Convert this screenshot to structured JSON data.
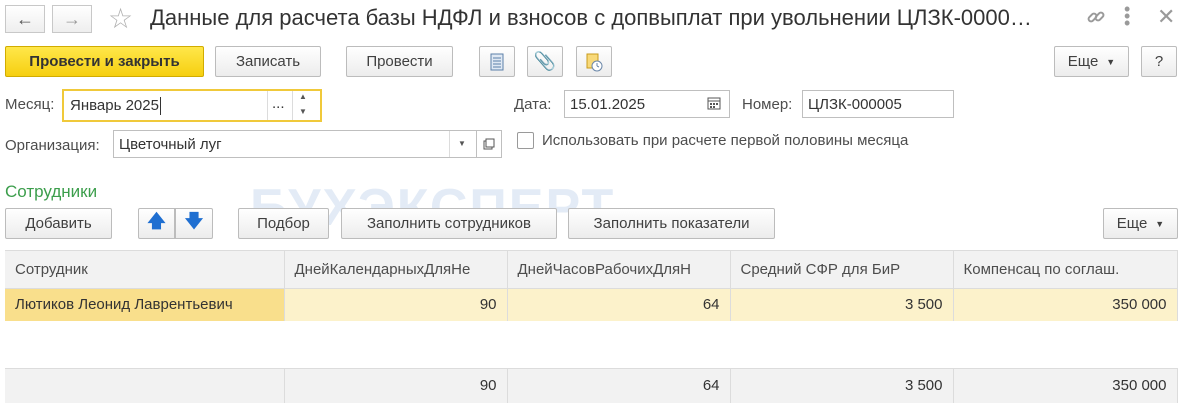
{
  "header": {
    "title": "Данные для расчета базы НДФЛ и взносов с допвыплат при увольнении ЦЛЗК-0000…"
  },
  "toolbar": {
    "post_close": "Провести и закрыть",
    "save": "Записать",
    "post": "Провести",
    "more": "Еще",
    "help": "?"
  },
  "form": {
    "month_label": "Месяц:",
    "month_value": "Январь 2025",
    "date_label": "Дата:",
    "date_value": "15.01.2025",
    "number_label": "Номер:",
    "number_value": "ЦЛЗК-000005",
    "org_label": "Организация:",
    "org_value": "Цветочный луг",
    "first_half_label": "Использовать при расчете первой половины месяца"
  },
  "employees": {
    "title": "Сотрудники",
    "add": "Добавить",
    "select": "Подбор",
    "fill_employees": "Заполнить сотрудников",
    "fill_indicators": "Заполнить показатели",
    "more": "Еще",
    "columns": [
      "Сотрудник",
      "ДнейКалендарныхДляНе",
      "ДнейЧасовРабочихДляН",
      "Средний СФР для БиР",
      "Компенсац по соглаш."
    ],
    "rows": [
      {
        "employee": "Лютиков Леонид Лаврентьевич",
        "days_cal": "90",
        "days_work": "64",
        "avg_sfr": "3 500",
        "compensation": "350 000"
      }
    ],
    "totals": {
      "days_cal": "90",
      "days_work": "64",
      "avg_sfr": "3 500",
      "compensation": "350 000"
    }
  },
  "watermark": "БУХЭКСПЕРТ"
}
